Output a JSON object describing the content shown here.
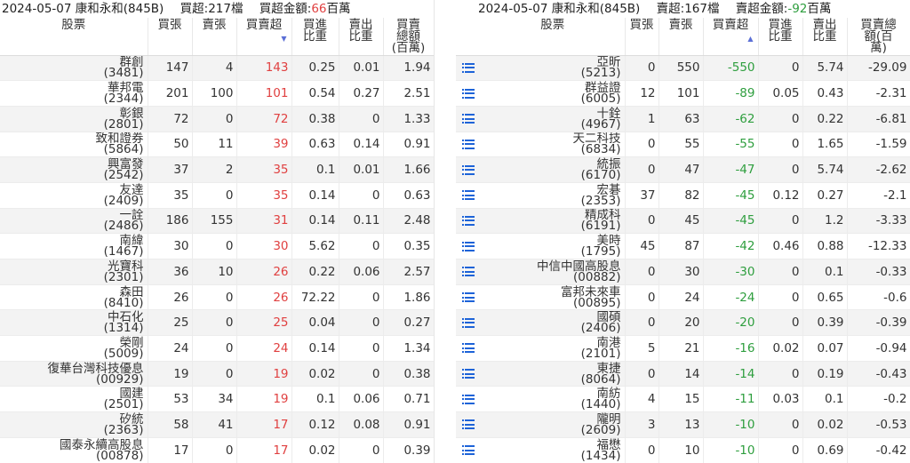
{
  "left": {
    "date": "2024-05-07",
    "broker": "康和永和(845B)",
    "summary_label": "買超:",
    "summary_count": "217檔",
    "amount_label": "買超金額:",
    "amount_value": "66",
    "amount_unit": "百萬",
    "headers": [
      "股票",
      "買張",
      "賣張",
      "買賣超",
      "買進比重",
      "賣出比重",
      "買賣總額(百萬)"
    ],
    "sort_indicator": "▼",
    "rows": [
      {
        "name": "群創",
        "code": "(3481)",
        "buy": "147",
        "sell": "4",
        "net": "143",
        "buy_pct": "0.25",
        "sell_pct": "0.01",
        "total": "1.94"
      },
      {
        "name": "華邦電",
        "code": "(2344)",
        "buy": "201",
        "sell": "100",
        "net": "101",
        "buy_pct": "0.54",
        "sell_pct": "0.27",
        "total": "2.51"
      },
      {
        "name": "彰銀",
        "code": "(2801)",
        "buy": "72",
        "sell": "0",
        "net": "72",
        "buy_pct": "0.38",
        "sell_pct": "0",
        "total": "1.33"
      },
      {
        "name": "致和證券",
        "code": "(5864)",
        "buy": "50",
        "sell": "11",
        "net": "39",
        "buy_pct": "0.63",
        "sell_pct": "0.14",
        "total": "0.91"
      },
      {
        "name": "興富發",
        "code": "(2542)",
        "buy": "37",
        "sell": "2",
        "net": "35",
        "buy_pct": "0.1",
        "sell_pct": "0.01",
        "total": "1.66"
      },
      {
        "name": "友達",
        "code": "(2409)",
        "buy": "35",
        "sell": "0",
        "net": "35",
        "buy_pct": "0.14",
        "sell_pct": "0",
        "total": "0.63"
      },
      {
        "name": "一詮",
        "code": "(2486)",
        "buy": "186",
        "sell": "155",
        "net": "31",
        "buy_pct": "0.14",
        "sell_pct": "0.11",
        "total": "2.48"
      },
      {
        "name": "南緯",
        "code": "(1467)",
        "buy": "30",
        "sell": "0",
        "net": "30",
        "buy_pct": "5.62",
        "sell_pct": "0",
        "total": "0.35"
      },
      {
        "name": "光寶科",
        "code": "(2301)",
        "buy": "36",
        "sell": "10",
        "net": "26",
        "buy_pct": "0.22",
        "sell_pct": "0.06",
        "total": "2.57"
      },
      {
        "name": "森田",
        "code": "(8410)",
        "buy": "26",
        "sell": "0",
        "net": "26",
        "buy_pct": "72.22",
        "sell_pct": "0",
        "total": "1.86"
      },
      {
        "name": "中石化",
        "code": "(1314)",
        "buy": "25",
        "sell": "0",
        "net": "25",
        "buy_pct": "0.04",
        "sell_pct": "0",
        "total": "0.27"
      },
      {
        "name": "榮剛",
        "code": "(5009)",
        "buy": "24",
        "sell": "0",
        "net": "24",
        "buy_pct": "0.14",
        "sell_pct": "0",
        "total": "1.34"
      },
      {
        "name": "復華台灣科技優息",
        "code": "(00929)",
        "buy": "19",
        "sell": "0",
        "net": "19",
        "buy_pct": "0.02",
        "sell_pct": "0",
        "total": "0.38"
      },
      {
        "name": "國建",
        "code": "(2501)",
        "buy": "53",
        "sell": "34",
        "net": "19",
        "buy_pct": "0.1",
        "sell_pct": "0.06",
        "total": "0.71"
      },
      {
        "name": "矽統",
        "code": "(2363)",
        "buy": "58",
        "sell": "41",
        "net": "17",
        "buy_pct": "0.12",
        "sell_pct": "0.08",
        "total": "0.91"
      },
      {
        "name": "國泰永續高股息",
        "code": "(00878)",
        "buy": "17",
        "sell": "0",
        "net": "17",
        "buy_pct": "0.02",
        "sell_pct": "0",
        "total": "0.39"
      }
    ]
  },
  "right": {
    "date": "2024-05-07",
    "broker": "康和永和(845B)",
    "summary_label": "賣超:",
    "summary_count": "167檔",
    "amount_label": "賣超金額:",
    "amount_value": "-92",
    "amount_unit": "百萬",
    "headers": [
      "股票",
      "買張",
      "賣張",
      "買賣超",
      "買進比重",
      "賣出比重",
      "買賣總額(百萬)"
    ],
    "sort_indicator": "▲",
    "rows": [
      {
        "name": "亞昕",
        "code": "(5213)",
        "buy": "0",
        "sell": "550",
        "net": "-550",
        "buy_pct": "0",
        "sell_pct": "5.74",
        "total": "-29.09"
      },
      {
        "name": "群益證",
        "code": "(6005)",
        "buy": "12",
        "sell": "101",
        "net": "-89",
        "buy_pct": "0.05",
        "sell_pct": "0.43",
        "total": "-2.31"
      },
      {
        "name": "十銓",
        "code": "(4967)",
        "buy": "1",
        "sell": "63",
        "net": "-62",
        "buy_pct": "0",
        "sell_pct": "0.22",
        "total": "-6.81"
      },
      {
        "name": "天二科技",
        "code": "(6834)",
        "buy": "0",
        "sell": "55",
        "net": "-55",
        "buy_pct": "0",
        "sell_pct": "1.65",
        "total": "-1.59"
      },
      {
        "name": "統振",
        "code": "(6170)",
        "buy": "0",
        "sell": "47",
        "net": "-47",
        "buy_pct": "0",
        "sell_pct": "5.74",
        "total": "-2.62"
      },
      {
        "name": "宏碁",
        "code": "(2353)",
        "buy": "37",
        "sell": "82",
        "net": "-45",
        "buy_pct": "0.12",
        "sell_pct": "0.27",
        "total": "-2.1"
      },
      {
        "name": "精成科",
        "code": "(6191)",
        "buy": "0",
        "sell": "45",
        "net": "-45",
        "buy_pct": "0",
        "sell_pct": "1.2",
        "total": "-3.33"
      },
      {
        "name": "美時",
        "code": "(1795)",
        "buy": "45",
        "sell": "87",
        "net": "-42",
        "buy_pct": "0.46",
        "sell_pct": "0.88",
        "total": "-12.33"
      },
      {
        "name": "中信中國高股息",
        "code": "(00882)",
        "buy": "0",
        "sell": "30",
        "net": "-30",
        "buy_pct": "0",
        "sell_pct": "0.1",
        "total": "-0.33"
      },
      {
        "name": "富邦未來車",
        "code": "(00895)",
        "buy": "0",
        "sell": "24",
        "net": "-24",
        "buy_pct": "0",
        "sell_pct": "0.65",
        "total": "-0.6"
      },
      {
        "name": "國碩",
        "code": "(2406)",
        "buy": "0",
        "sell": "20",
        "net": "-20",
        "buy_pct": "0",
        "sell_pct": "0.39",
        "total": "-0.39"
      },
      {
        "name": "南港",
        "code": "(2101)",
        "buy": "5",
        "sell": "21",
        "net": "-16",
        "buy_pct": "0.02",
        "sell_pct": "0.07",
        "total": "-0.94"
      },
      {
        "name": "東捷",
        "code": "(8064)",
        "buy": "0",
        "sell": "14",
        "net": "-14",
        "buy_pct": "0",
        "sell_pct": "0.19",
        "total": "-0.43"
      },
      {
        "name": "南紡",
        "code": "(1440)",
        "buy": "4",
        "sell": "15",
        "net": "-11",
        "buy_pct": "0.03",
        "sell_pct": "0.1",
        "total": "-0.2"
      },
      {
        "name": "隴明",
        "code": "(2609)",
        "buy": "3",
        "sell": "13",
        "net": "-10",
        "buy_pct": "0",
        "sell_pct": "0.02",
        "total": "-0.53"
      },
      {
        "name": "福懋",
        "code": "(1434)",
        "buy": "0",
        "sell": "10",
        "net": "-10",
        "buy_pct": "0",
        "sell_pct": "0.69",
        "total": "-0.42"
      }
    ]
  },
  "colors": {
    "positive": "#e04040",
    "negative": "#2e9e3e",
    "icon": "#1d63d8"
  },
  "icons": {
    "row_detail": "list-icon"
  }
}
